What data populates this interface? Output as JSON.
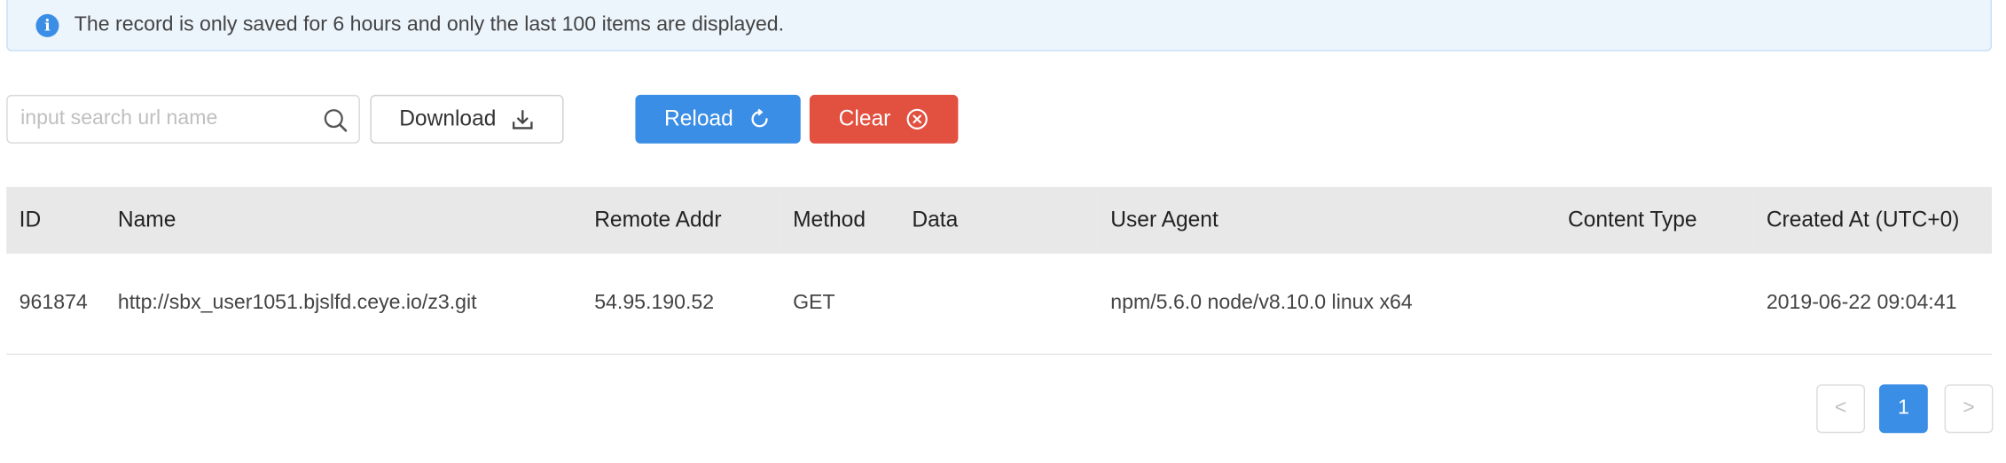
{
  "alert": {
    "icon": "info-icon",
    "icon_glyph": "i",
    "message": "The record is only saved for 6 hours and only the last 100 items are displayed."
  },
  "toolbar": {
    "search_placeholder": "input search url name",
    "search_value": "",
    "search_icon": "search-icon",
    "download_label": "Download",
    "download_icon": "download-icon",
    "reload_label": "Reload",
    "reload_icon": "refresh-icon",
    "clear_label": "Clear",
    "clear_icon": "close-circle-icon"
  },
  "table": {
    "columns": [
      "ID",
      "Name",
      "Remote Addr",
      "Method",
      "Data",
      "User Agent",
      "Content Type",
      "Created At (UTC+0)"
    ],
    "rows": [
      {
        "id": "961874",
        "name": "http://sbx_user1051.bjslfd.ceye.io/z3.git",
        "remote_addr": "54.95.190.52",
        "method": "GET",
        "data": "",
        "user_agent": "npm/5.6.0 node/v8.10.0 linux x64",
        "content_type": "",
        "created_at": "2019-06-22 09:04:41"
      }
    ]
  },
  "pagination": {
    "prev_glyph": "<",
    "current_page": "1",
    "next_glyph": ">"
  },
  "colors": {
    "primary": "#3b8ee5",
    "danger": "#e25040",
    "alert_bg": "#ecf4fc",
    "header_bg": "#e8e8e8"
  }
}
